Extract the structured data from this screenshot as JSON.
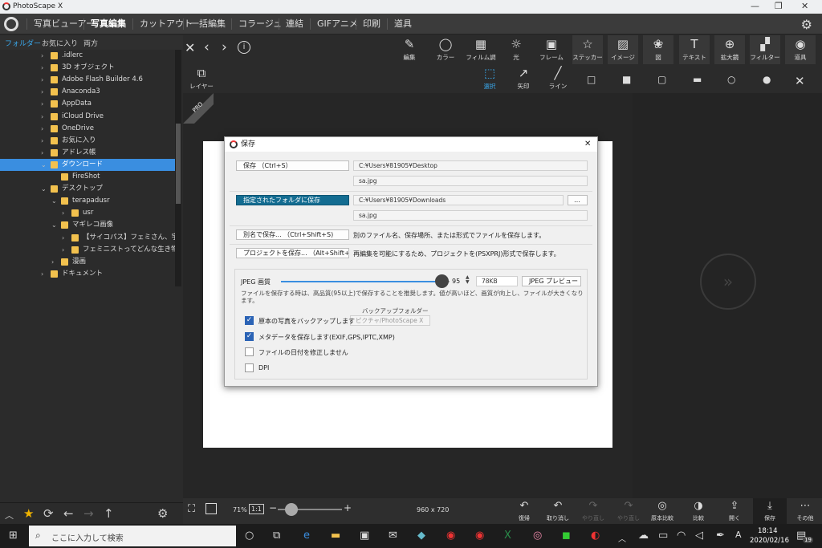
{
  "window": {
    "title": "PhotoScape X",
    "minimize": "—",
    "maximize": "❐",
    "close": "✕"
  },
  "menu": [
    "写真ビューアー",
    "写真編集",
    "カットアウト",
    "一括編集",
    "コラージュ",
    "連結",
    "GIFアニメ",
    "印刷",
    "道具"
  ],
  "menu_active": "写真編集",
  "sidebar": {
    "tabs": [
      "フォルダー",
      "お気に入り",
      "両方"
    ],
    "tree": [
      {
        "label": ".idlerc",
        "indent": 1,
        "arrow": "›",
        "selected": false
      },
      {
        "label": "3D オブジェクト",
        "indent": 1,
        "arrow": "›",
        "selected": false
      },
      {
        "label": "Adobe Flash Builder 4.6",
        "indent": 1,
        "arrow": "›",
        "selected": false
      },
      {
        "label": "Anaconda3",
        "indent": 1,
        "arrow": "›",
        "selected": false
      },
      {
        "label": "AppData",
        "indent": 1,
        "arrow": "›",
        "selected": false
      },
      {
        "label": "iCloud Drive",
        "indent": 1,
        "arrow": "›",
        "selected": false
      },
      {
        "label": "OneDrive",
        "indent": 1,
        "arrow": "›",
        "selected": false
      },
      {
        "label": "お気に入り",
        "indent": 1,
        "arrow": "›",
        "selected": false
      },
      {
        "label": "アドレス帳",
        "indent": 1,
        "arrow": "›",
        "selected": false
      },
      {
        "label": "ダウンロード",
        "indent": 1,
        "arrow": "⌄",
        "selected": true
      },
      {
        "label": "FireShot",
        "indent": 2,
        "arrow": "",
        "selected": false
      },
      {
        "label": "デスクトップ",
        "indent": 1,
        "arrow": "⌄",
        "selected": false
      },
      {
        "label": "terapadusr",
        "indent": 2,
        "arrow": "⌄",
        "selected": false
      },
      {
        "label": "usr",
        "indent": 3,
        "arrow": "›",
        "selected": false
      },
      {
        "label": "マギレコ画像",
        "indent": 2,
        "arrow": "⌄",
        "selected": false
      },
      {
        "label": "【サイコパス】フェミさん、宇崎ち",
        "indent": 3,
        "arrow": "›",
        "selected": false
      },
      {
        "label": "フェミニストってどんな生き物？",
        "indent": 3,
        "arrow": "›",
        "selected": false
      },
      {
        "label": "漫画",
        "indent": 2,
        "arrow": "›",
        "selected": false
      },
      {
        "label": "ドキュメント",
        "indent": 1,
        "arrow": "›",
        "selected": false
      }
    ]
  },
  "tools": [
    {
      "label": "編集",
      "icon": "✎"
    },
    {
      "label": "カラー",
      "icon": "◯"
    },
    {
      "label": "フィルム調",
      "icon": "▦"
    },
    {
      "label": "光",
      "icon": "☼"
    },
    {
      "label": "フレーム",
      "icon": "▣"
    },
    {
      "label": "ステッカー",
      "icon": "☆"
    },
    {
      "label": "イメージ",
      "icon": "▨"
    },
    {
      "label": "図",
      "icon": "❀"
    },
    {
      "label": "テキスト",
      "icon": "T"
    },
    {
      "label": "拡大鏡",
      "icon": "⊕"
    },
    {
      "label": "フィルター",
      "icon": "▞"
    },
    {
      "label": "道具",
      "icon": "◉"
    }
  ],
  "sub_tools": [
    {
      "label": "選択",
      "icon": "⬚"
    },
    {
      "label": "矢印",
      "icon": "↗"
    },
    {
      "label": "ライン",
      "icon": "╱"
    }
  ],
  "shapes": [
    "□",
    "■",
    "▢",
    "▬",
    "○",
    "●",
    "✕"
  ],
  "layer_label": "レイヤー",
  "pro_badge": "PRO",
  "bottom": {
    "zoom": "71%",
    "ratio": "1:1",
    "minus": "−",
    "plus": "+",
    "size": "960 x 720",
    "buttons": [
      {
        "label": "復帰",
        "icon": "↶",
        "dim": false
      },
      {
        "label": "取り消し",
        "icon": "↶",
        "dim": false
      },
      {
        "label": "やり直し",
        "icon": "↷",
        "dim": true
      },
      {
        "label": "やり直し",
        "icon": "↷",
        "dim": true
      },
      {
        "label": "原本比較",
        "icon": "◎",
        "dim": false
      },
      {
        "label": "比較",
        "icon": "◑",
        "dim": false
      },
      {
        "label": "開く",
        "icon": "⇪",
        "dim": false
      },
      {
        "label": "保存",
        "icon": "⤓",
        "dim": false
      },
      {
        "label": "その他",
        "icon": "⋯",
        "dim": false
      }
    ]
  },
  "dialog": {
    "title": "保存",
    "close": "✕",
    "save_button": "保存 （Ctrl+S）",
    "save_path": "C:¥Users¥81905¥Desktop",
    "save_file": "sa.jpg",
    "folder_button": "指定されたフォルダに保存",
    "folder_path": "C:¥Users¥81905¥Downloads",
    "folder_file": "sa.jpg",
    "browse": "…",
    "saveas_button": "別名で保存... （Ctrl+Shift+S)",
    "saveas_desc": "別のファイル名、保存場所、または形式でファイルを保存します。",
    "project_button": "プロジェクトを保存... （Alt+Shift+S)",
    "project_desc": "再編集を可能にするため、プロジェクトを(PSXPRJ)形式で保存します。",
    "jpeg_label": "JPEG 画質",
    "quality": "95",
    "quality_value": 95,
    "filesize": "78KB",
    "preview_button": "JPEG プレビュー",
    "quality_note": "ファイルを保存する時は、高品質(95以上)で保存することを推奨します。値が高いほど、画質が向上し、ファイルが大きくなります。",
    "backup_folder_label": "バックアップフォルダー",
    "backup_folder_value": "ピクチャ/PhotoScape X",
    "options": [
      {
        "label": "原本の写真をバックアップします",
        "checked": true
      },
      {
        "label": "メタデータを保存します(EXIF,GPS,IPTC,XMP)",
        "checked": true
      },
      {
        "label": "ファイルの日付を修正しません",
        "checked": false
      },
      {
        "label": "DPI",
        "checked": false
      }
    ]
  },
  "taskbar": {
    "search": "ここに入力して検索",
    "time": "18:14",
    "date": "2020/02/16",
    "ime": "A",
    "notif": "19"
  }
}
